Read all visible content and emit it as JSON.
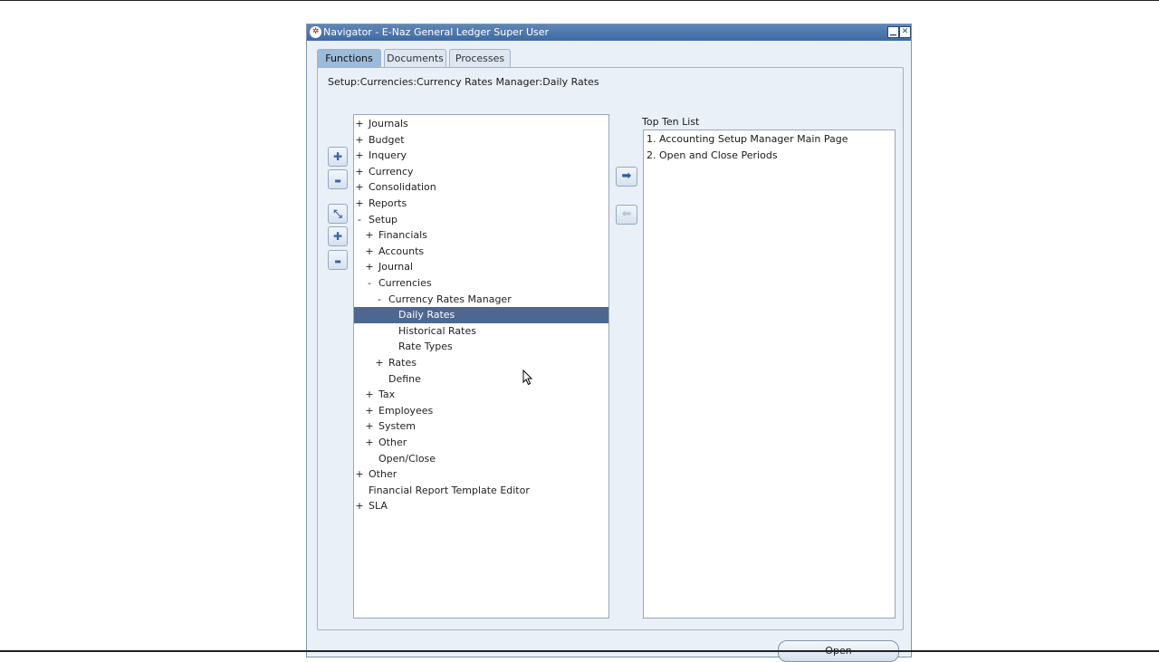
{
  "window": {
    "title": "Navigator - E-Naz General Ledger Super User"
  },
  "tabs": [
    "Functions",
    "Documents",
    "Processes"
  ],
  "active_tab": "Functions",
  "path": "Setup:Currencies:Currency Rates Manager:Daily Rates",
  "tree": [
    {
      "sign": "+",
      "label": "Journals",
      "level": 0
    },
    {
      "sign": "+",
      "label": "Budget",
      "level": 0
    },
    {
      "sign": "+",
      "label": "Inquery",
      "level": 0
    },
    {
      "sign": "+",
      "label": "Currency",
      "level": 0
    },
    {
      "sign": "+",
      "label": "Consolidation",
      "level": 0
    },
    {
      "sign": "+",
      "label": "Reports",
      "level": 0
    },
    {
      "sign": "-",
      "label": "Setup",
      "level": 0
    },
    {
      "sign": "+",
      "label": "Financials",
      "level": 1
    },
    {
      "sign": "+",
      "label": "Accounts",
      "level": 1
    },
    {
      "sign": "+",
      "label": "Journal",
      "level": 1
    },
    {
      "sign": "-",
      "label": "Currencies",
      "level": 1
    },
    {
      "sign": "-",
      "label": "Currency Rates Manager",
      "level": 2
    },
    {
      "sign": "",
      "label": "Daily Rates",
      "level": 3,
      "selected": true
    },
    {
      "sign": "",
      "label": "Historical Rates",
      "level": 3
    },
    {
      "sign": "",
      "label": "Rate Types",
      "level": 3
    },
    {
      "sign": "+",
      "label": "Rates",
      "level": 2
    },
    {
      "sign": "",
      "label": "Define",
      "level": 2
    },
    {
      "sign": "+",
      "label": "Tax",
      "level": 1
    },
    {
      "sign": "+",
      "label": "Employees",
      "level": 1
    },
    {
      "sign": "+",
      "label": "System",
      "level": 1
    },
    {
      "sign": "+",
      "label": "Other",
      "level": 1
    },
    {
      "sign": "",
      "label": "Open/Close",
      "level": 1
    },
    {
      "sign": "+",
      "label": "Other",
      "level": 0
    },
    {
      "sign": "",
      "label": "Financial Report Template Editor",
      "level": 0
    },
    {
      "sign": "+",
      "label": "SLA",
      "level": 0
    }
  ],
  "side_buttons": [
    {
      "name": "expand-button",
      "icon": "plus-icon",
      "glyph": "✚"
    },
    {
      "name": "collapse-button",
      "icon": "minus-icon",
      "glyph": "▬"
    },
    {
      "name": "expand-branch-button",
      "icon": "expand-branch-icon",
      "glyph": "⤡"
    },
    {
      "name": "expand-all-button",
      "icon": "expand-all-icon",
      "glyph": "✚"
    },
    {
      "name": "collapse-all-button",
      "icon": "collapse-all-icon",
      "glyph": "▬"
    }
  ],
  "top_ten": {
    "label": "Top Ten List",
    "items": [
      "1. Accounting Setup Manager Main Page",
      "2. Open and Close Periods"
    ]
  },
  "buttons": {
    "open_label": "Open",
    "add_icon": "right-arrow-icon",
    "remove_icon": "left-arrow-icon"
  },
  "colors": {
    "title_bar": "#4a76ad",
    "selection": "#4d6790",
    "background": "#eaf0f7"
  }
}
